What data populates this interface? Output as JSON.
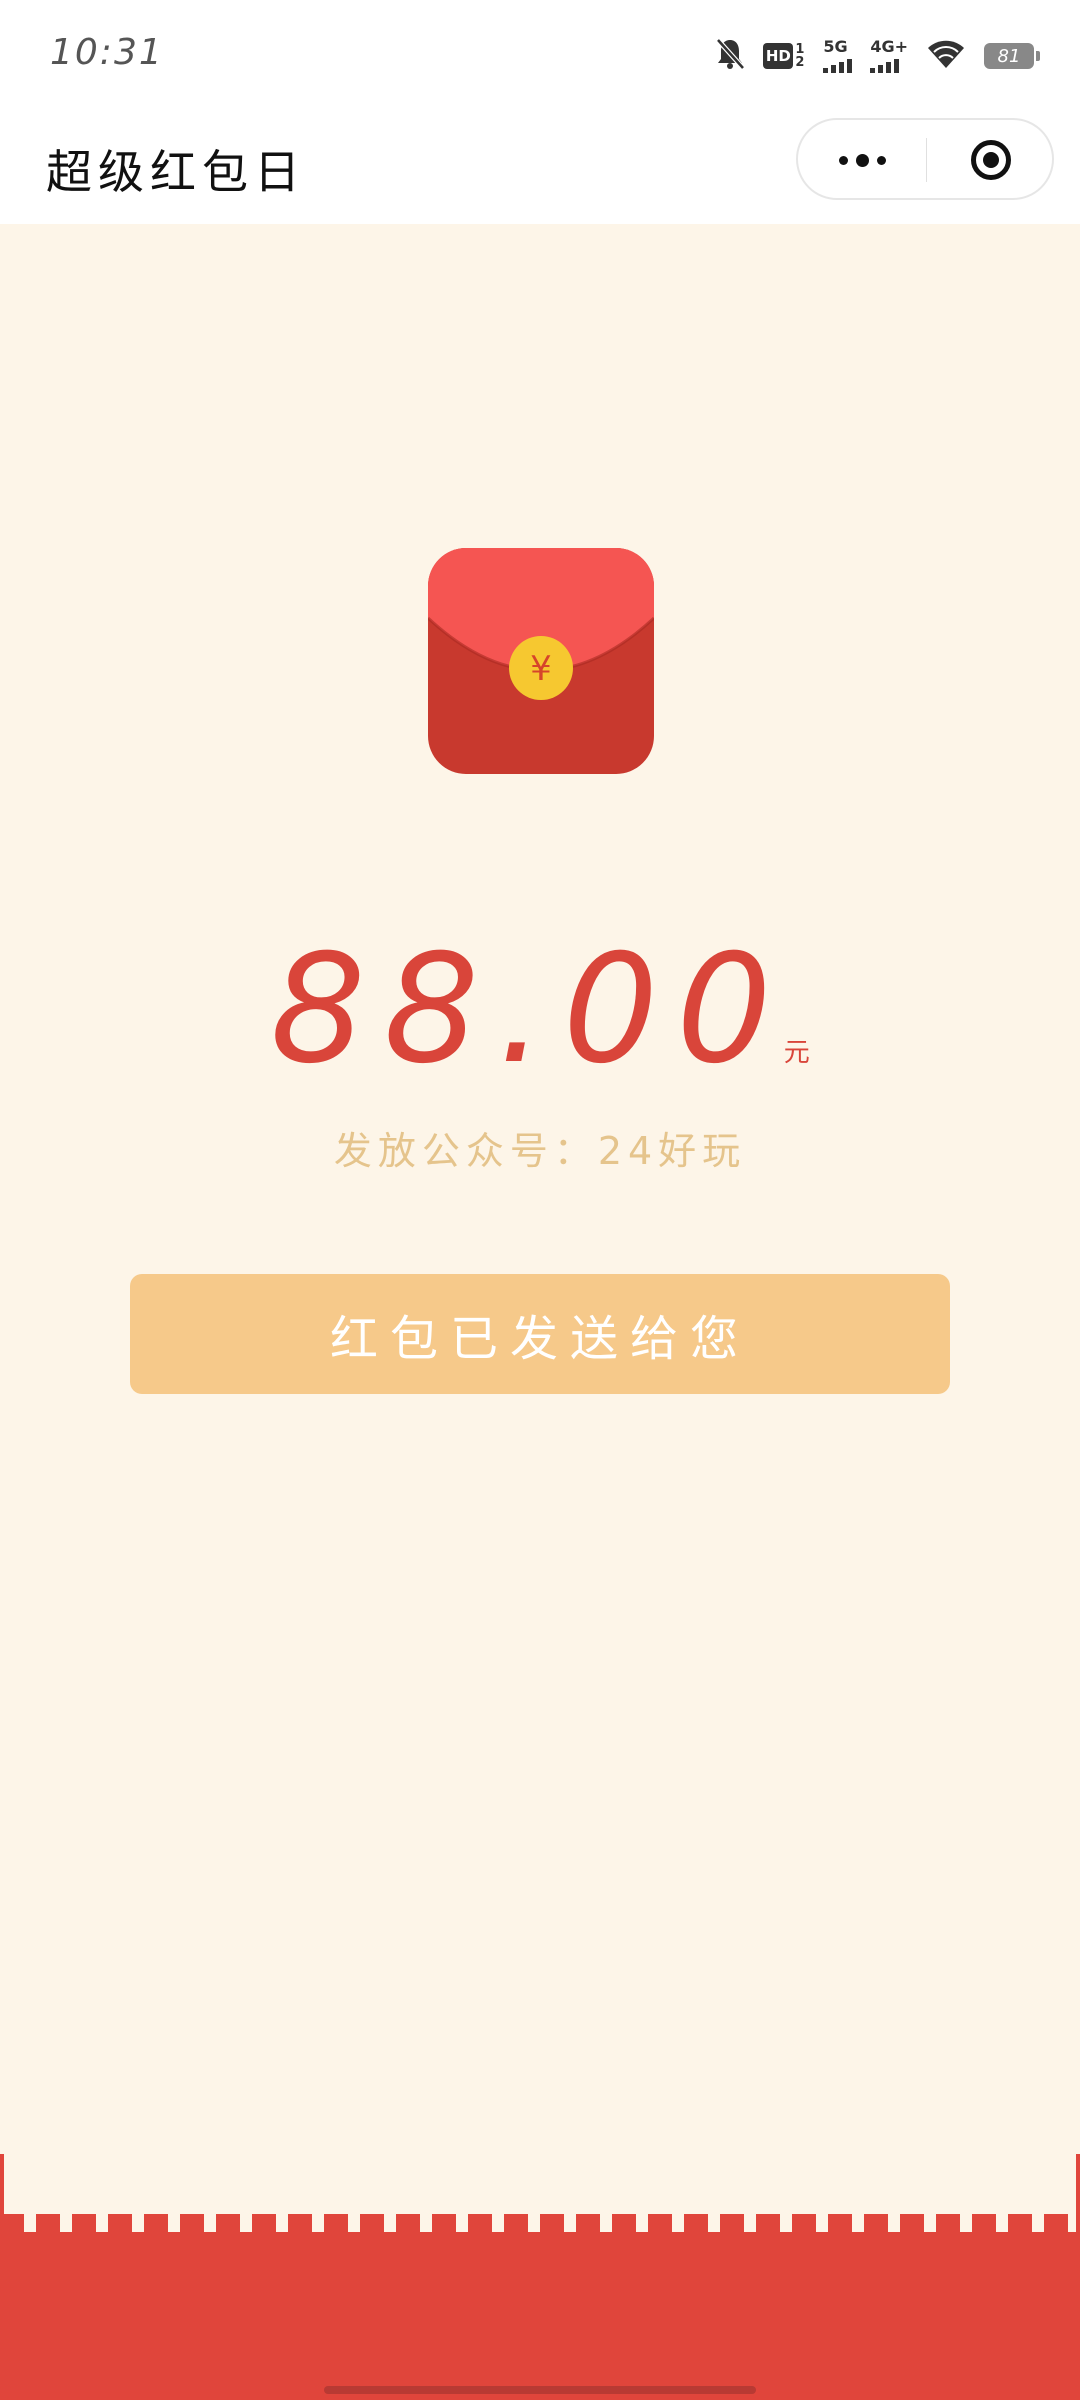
{
  "status_bar": {
    "time": "10:31",
    "hd_label": "HD",
    "hd_sub": "1 2",
    "signal_1_label": "5G",
    "signal_2_label": "4G+",
    "battery": "81",
    "icons": [
      "bell-muted-icon",
      "hd-icon",
      "signal-5g-icon",
      "signal-4g-icon",
      "wifi-icon",
      "battery-icon"
    ]
  },
  "nav": {
    "title": "超级红包日"
  },
  "envelope": {
    "symbol": "¥",
    "colors": {
      "top": "#f55552",
      "body": "#c8392e",
      "coin": "#f6c830",
      "symbol": "#d6452a"
    }
  },
  "amount": {
    "value": "88.00",
    "unit": "元"
  },
  "source_text": "发放公众号：24好玩",
  "cta_label": "红包已发送给您",
  "colors": {
    "background": "#fdf5e8",
    "accent_red": "#d9453a",
    "button": "#f6c98a",
    "footer": "#e0453b"
  }
}
